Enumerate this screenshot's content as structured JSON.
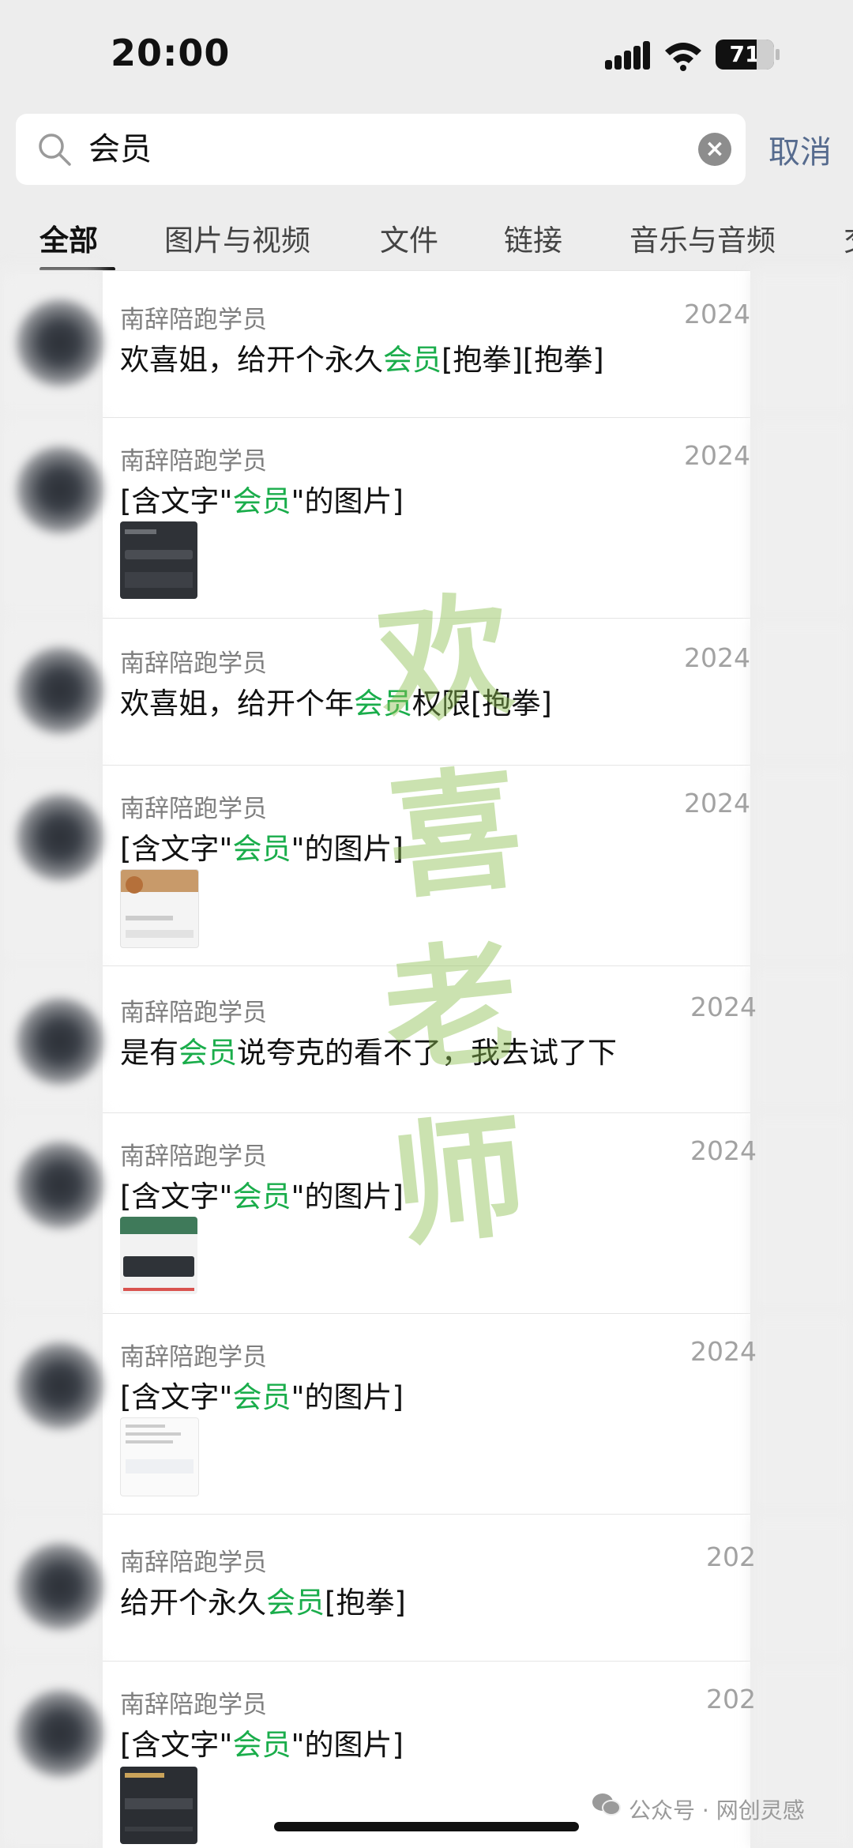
{
  "status_bar": {
    "time": "20:00",
    "battery": "71"
  },
  "search": {
    "query": "会员",
    "cancel_label": "取消"
  },
  "tabs": [
    {
      "label": "全部",
      "active": true
    },
    {
      "label": "图片与视频",
      "active": false
    },
    {
      "label": "文件",
      "active": false
    },
    {
      "label": "链接",
      "active": false
    },
    {
      "label": "音乐与音频",
      "active": false
    },
    {
      "label": "交",
      "active": false
    }
  ],
  "results": [
    {
      "sender": "南辞陪跑学员",
      "date": "2024",
      "pre": "欢喜姐，给开个永久",
      "hit": "会员",
      "post": "[抱拳][抱拳]",
      "has_image": false
    },
    {
      "sender": "南辞陪跑学员",
      "date": "2024",
      "pre": "[含文字\"",
      "hit": "会员",
      "post": "\"的图片]",
      "has_image": true
    },
    {
      "sender": "南辞陪跑学员",
      "date": "2024",
      "pre": "欢喜姐，给开个年",
      "hit": "会员",
      "post": "权限[抱拳]",
      "has_image": false
    },
    {
      "sender": "南辞陪跑学员",
      "date": "2024",
      "pre": "[含文字\"",
      "hit": "会员",
      "post": "\"的图片]",
      "has_image": true
    },
    {
      "sender": "南辞陪跑学员",
      "date": "2024",
      "pre": "是有",
      "hit": "会员",
      "post": "说夸克的看不了，我去试了下",
      "has_image": false
    },
    {
      "sender": "南辞陪跑学员",
      "date": "2024",
      "pre": "[含文字\"",
      "hit": "会员",
      "post": "\"的图片]",
      "has_image": true
    },
    {
      "sender": "南辞陪跑学员",
      "date": "2024",
      "pre": "[含文字\"",
      "hit": "会员",
      "post": "\"的图片]",
      "has_image": true
    },
    {
      "sender": "南辞陪跑学员",
      "date": "202",
      "pre": "给开个永久",
      "hit": "会员",
      "post": "[抱拳]",
      "has_image": false
    },
    {
      "sender": "南辞陪跑学员",
      "date": "202",
      "pre": "[含文字\"",
      "hit": "会员",
      "post": "\"的图片]",
      "has_image": true
    }
  ],
  "watermark": [
    "欢",
    "喜",
    "老",
    "师"
  ],
  "footer": {
    "text": "公众号 · 网创灵感"
  },
  "colors": {
    "highlight": "#1aad4b",
    "cancel": "#566b8e",
    "background": "#ededed"
  }
}
